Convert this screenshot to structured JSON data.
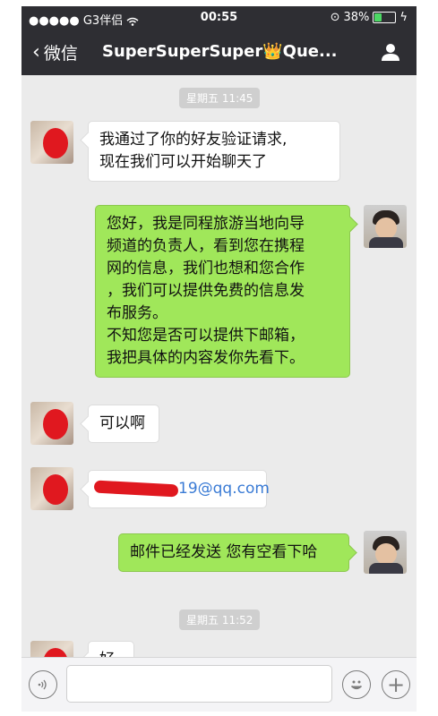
{
  "status": {
    "carrier": "●●●●● G3伴侣",
    "wifi_icon": "wifi-icon",
    "time": "00:55",
    "battery_percent": "38%",
    "battery_level": 0.38
  },
  "nav": {
    "back_label": "微信",
    "title": "SuperSuperSuper👑Que...",
    "person_icon": "person-icon"
  },
  "chat": {
    "timestamps": [
      "星期五 11:45",
      "星期五 11:52"
    ],
    "messages": [
      {
        "side": "left",
        "lines": [
          "我通过了你的好友验证请求,",
          "现在我们可以开始聊天了"
        ]
      },
      {
        "side": "right",
        "lines": [
          "您好，我是同程旅游当地向导",
          "频道的负责人，看到您在携程",
          "网的信息，我们也想和您合作",
          "，我们可以提供免费的信息发",
          "布服务。",
          "不知您是否可以提供下邮箱，",
          "我把具体的内容发你先看下。"
        ]
      },
      {
        "side": "left",
        "lines": [
          "可以啊"
        ]
      },
      {
        "side": "left",
        "text": "19@qq.com"
      },
      {
        "side": "right",
        "lines": [
          "邮件已经发送 您有空看下哈"
        ]
      },
      {
        "side": "left",
        "lines": [
          "好"
        ]
      }
    ]
  },
  "inputbar": {
    "voice_icon": "voice-icon",
    "emoji_icon": "emoji-icon",
    "plus_icon": "plus-icon"
  }
}
